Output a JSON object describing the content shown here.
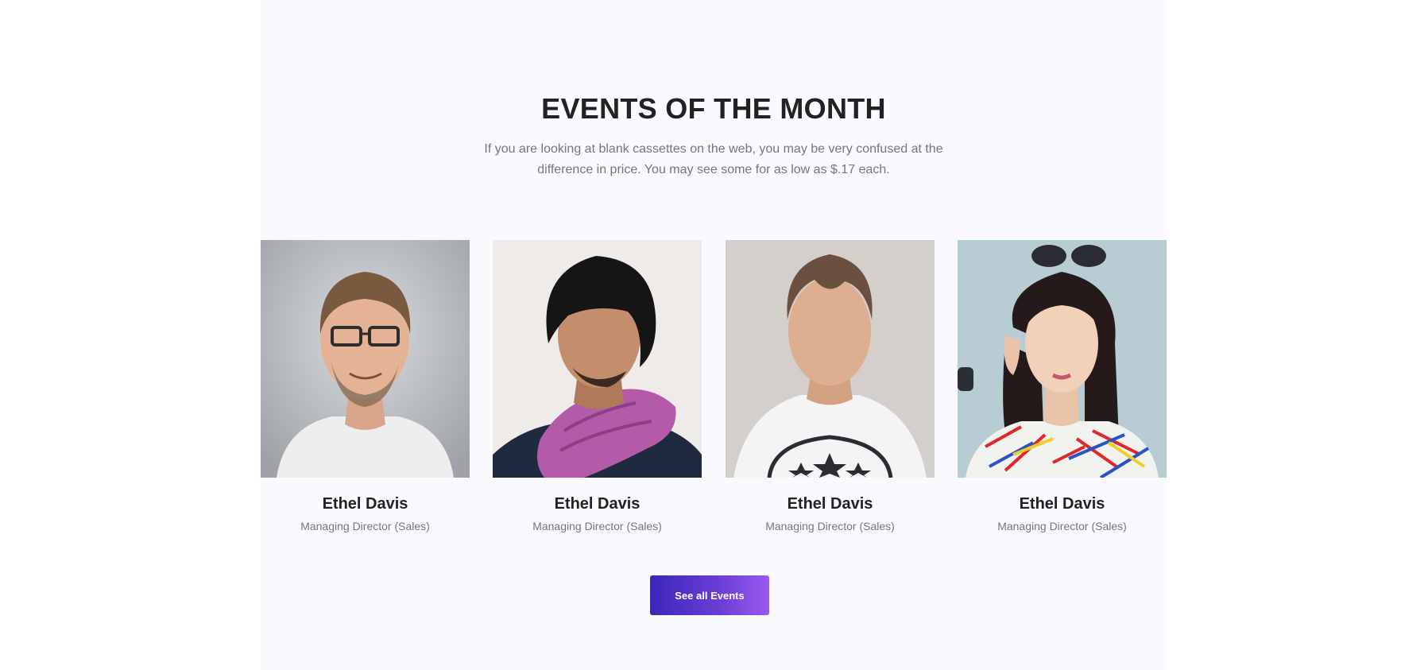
{
  "section": {
    "title": "EVENTS OF THE MONTH",
    "subtitle": "If you are looking at blank cassettes on the web, you may be very confused at the difference in price. You may see some for as low as $.17 each."
  },
  "events": [
    {
      "name": "Ethel Davis",
      "role": "Managing Director (Sales)",
      "photo": "man-with-glasses-photo"
    },
    {
      "name": "Ethel Davis",
      "role": "Managing Director (Sales)",
      "photo": "man-with-purple-scarf-photo"
    },
    {
      "name": "Ethel Davis",
      "role": "Managing Director (Sales)",
      "photo": "man-in-white-tshirt-photo"
    },
    {
      "name": "Ethel Davis",
      "role": "Managing Director (Sales)",
      "photo": "woman-with-sunglasses-photo"
    }
  ],
  "cta": {
    "label": "See all Events"
  },
  "colors": {
    "section_bg": "#f9f9fe",
    "title": "#222222",
    "muted_text": "#777777",
    "button_gradient_start": "#3b26b9",
    "button_gradient_end": "#9a5af0"
  }
}
